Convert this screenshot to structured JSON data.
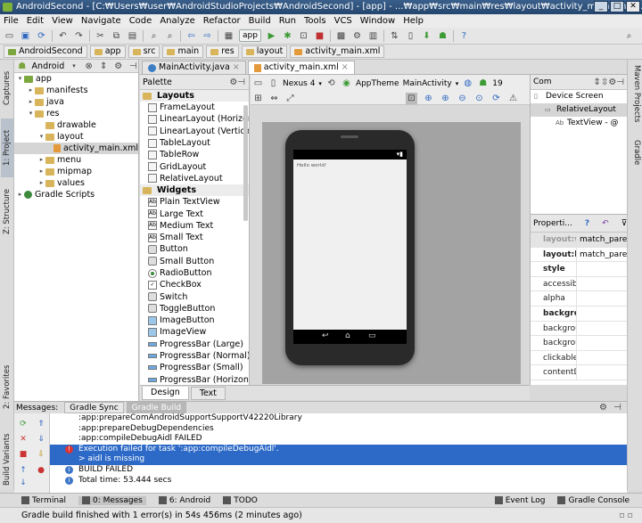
{
  "window": {
    "title": "AndroidSecond - [C:₩Users₩user₩AndroidStudioProjects₩AndroidSecond] - [app] - ...₩app₩src₩main₩res₩layout₩activity_main.xml - ..."
  },
  "menu": [
    "File",
    "Edit",
    "View",
    "Navigate",
    "Code",
    "Analyze",
    "Refactor",
    "Build",
    "Run",
    "Tools",
    "VCS",
    "Window",
    "Help"
  ],
  "toolbar": {
    "run_config": "app"
  },
  "breadcrumbs": [
    "AndroidSecond",
    "app",
    "src",
    "main",
    "res",
    "layout",
    "activity_main.xml"
  ],
  "left_stripe": {
    "project": "1: Project",
    "structure": "Z: Structure",
    "captures": "Captures",
    "favorites": "2: Favorites",
    "build_variants": "Build Variants"
  },
  "right_stripe": {
    "maven": "Maven Projects",
    "gradle": "Gradle"
  },
  "project": {
    "view_selector": "Android",
    "tree": [
      {
        "label": "app",
        "level": 0,
        "arrow": "▾",
        "icon": "app"
      },
      {
        "label": "manifests",
        "level": 1,
        "arrow": "▸",
        "icon": "folder"
      },
      {
        "label": "java",
        "level": 1,
        "arrow": "▸",
        "icon": "folder"
      },
      {
        "label": "res",
        "level": 1,
        "arrow": "▾",
        "icon": "folder"
      },
      {
        "label": "drawable",
        "level": 2,
        "arrow": "",
        "icon": "folder"
      },
      {
        "label": "layout",
        "level": 2,
        "arrow": "▾",
        "icon": "folder"
      },
      {
        "label": "activity_main.xml",
        "level": 3,
        "arrow": "",
        "icon": "xml",
        "selected": true
      },
      {
        "label": "menu",
        "level": 2,
        "arrow": "▸",
        "icon": "folder"
      },
      {
        "label": "mipmap",
        "level": 2,
        "arrow": "▸",
        "icon": "folder"
      },
      {
        "label": "values",
        "level": 2,
        "arrow": "▸",
        "icon": "folder"
      },
      {
        "label": "Gradle Scripts",
        "level": 0,
        "arrow": "▸",
        "icon": "gradle"
      }
    ]
  },
  "editor_tabs": [
    {
      "label": "MainActivity.java",
      "icon": "class",
      "active": false
    },
    {
      "label": "activity_main.xml",
      "icon": "xml",
      "active": true
    }
  ],
  "palette": {
    "title": "Palette",
    "groups": [
      {
        "name": "Layouts",
        "items": [
          "FrameLayout",
          "LinearLayout (Horizontal)",
          "LinearLayout (Vertical)",
          "TableLayout",
          "TableRow",
          "GridLayout",
          "RelativeLayout"
        ]
      },
      {
        "name": "Widgets",
        "items": [
          "Plain TextView",
          "Large Text",
          "Medium Text",
          "Small Text",
          "Button",
          "Small Button",
          "RadioButton",
          "CheckBox",
          "Switch",
          "ToggleButton",
          "ImageButton",
          "ImageView",
          "ProgressBar (Large)",
          "ProgressBar (Normal)",
          "ProgressBar (Small)",
          "ProgressBar (Horizontal)"
        ]
      }
    ]
  },
  "design": {
    "device": "Nexus 4",
    "theme": "AppTheme",
    "activity": "MainActivity",
    "api": "19",
    "hello_text": "Hello world!",
    "tabs": [
      "Design",
      "Text"
    ]
  },
  "component_tree": {
    "title": "Com",
    "items": [
      {
        "label": "Device Screen",
        "level": 0
      },
      {
        "label": "RelativeLayout",
        "level": 1,
        "selected": true
      },
      {
        "label": "TextView - @",
        "level": 2
      }
    ]
  },
  "properties": {
    "title": "Properti...",
    "rows": [
      {
        "name": "layout:w",
        "value": "match_parer",
        "bold": true,
        "highlight": true
      },
      {
        "name": "layout:h",
        "value": "match_parer",
        "bold": true
      },
      {
        "name": "style",
        "value": "",
        "bold": true
      },
      {
        "name": "accessib",
        "value": ""
      },
      {
        "name": "alpha",
        "value": ""
      },
      {
        "name": "backgro",
        "value": "",
        "bold": true
      },
      {
        "name": "backgrou",
        "value": ""
      },
      {
        "name": "backgrou",
        "value": ""
      },
      {
        "name": "clickable",
        "value": "",
        "checkbox": true
      },
      {
        "name": "contentDe",
        "value": ""
      }
    ]
  },
  "messages": {
    "label": "Messages:",
    "tabs": [
      "Gradle Sync",
      "Gradle Build"
    ],
    "lines": [
      {
        "text": ":app:prepareComAndroidSupportSupportV42220Library",
        "icon": ""
      },
      {
        "text": ":app:prepareDebugDependencies",
        "icon": ""
      },
      {
        "text": ":app:compileDebugAidl FAILED",
        "icon": ""
      },
      {
        "text": "Execution failed for task ':app:compileDebugAidl'.",
        "icon": "err",
        "selected": true
      },
      {
        "text": "> aidl is missing",
        "icon": "",
        "selected": true
      },
      {
        "text": "BUILD FAILED",
        "icon": "info"
      },
      {
        "text": "Total time: 53.444 secs",
        "icon": "info"
      }
    ]
  },
  "bottom_tabs": {
    "left": [
      "Terminal",
      "0: Messages",
      "6: Android",
      "TODO"
    ],
    "right": [
      "Event Log",
      "Gradle Console"
    ]
  },
  "status": "Gradle build finished with 1 error(s) in 54s 456ms (2 minutes ago)",
  "colors": {
    "selection": "#2d6ac7",
    "title_bar": "#24466f"
  }
}
